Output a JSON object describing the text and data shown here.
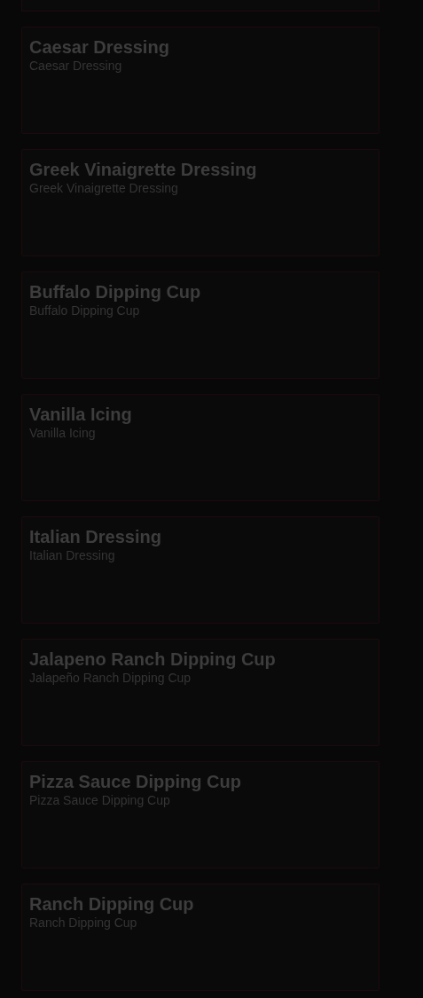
{
  "items": [
    {
      "title": "Caesar Dressing",
      "subtitle": "Caesar Dressing"
    },
    {
      "title": "Greek Vinaigrette Dressing",
      "subtitle": "Greek Vinaigrette Dressing"
    },
    {
      "title": "Buffalo Dipping Cup",
      "subtitle": "Buffalo Dipping Cup"
    },
    {
      "title": "Vanilla Icing",
      "subtitle": "Vanilla Icing"
    },
    {
      "title": "Italian Dressing",
      "subtitle": "Italian Dressing"
    },
    {
      "title": "Jalapeno Ranch Dipping Cup",
      "subtitle": "Jalapeño Ranch Dipping Cup"
    },
    {
      "title": "Pizza Sauce Dipping Cup",
      "subtitle": "Pizza Sauce Dipping Cup"
    },
    {
      "title": "Ranch Dipping Cup",
      "subtitle": "Ranch Dipping Cup"
    }
  ]
}
